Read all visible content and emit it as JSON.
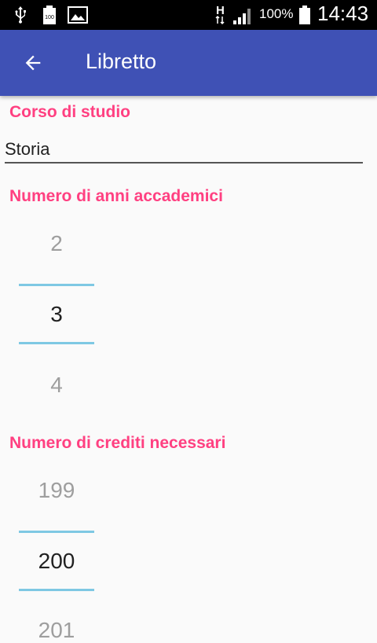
{
  "status_bar": {
    "battery_percent": "100%",
    "time": "14:43",
    "network_label": "H",
    "icons": [
      "usb-icon",
      "battery-full-small-icon",
      "image-icon",
      "h-network-icon",
      "signal-icon",
      "battery-icon"
    ]
  },
  "app_bar": {
    "title": "Libretto",
    "back_icon": "arrow-back-icon",
    "color": "#3f51b5"
  },
  "form": {
    "course": {
      "label": "Corso di studio",
      "value": "Storia"
    },
    "years": {
      "label": "Numero di anni accademici",
      "prev": "2",
      "selected": "3",
      "next": "4"
    },
    "credits": {
      "label": "Numero di crediti necessari",
      "prev": "199",
      "selected": "200",
      "next": "201"
    }
  },
  "colors": {
    "accent": "#ff4081",
    "picker_divider": "#7ec8e3"
  }
}
